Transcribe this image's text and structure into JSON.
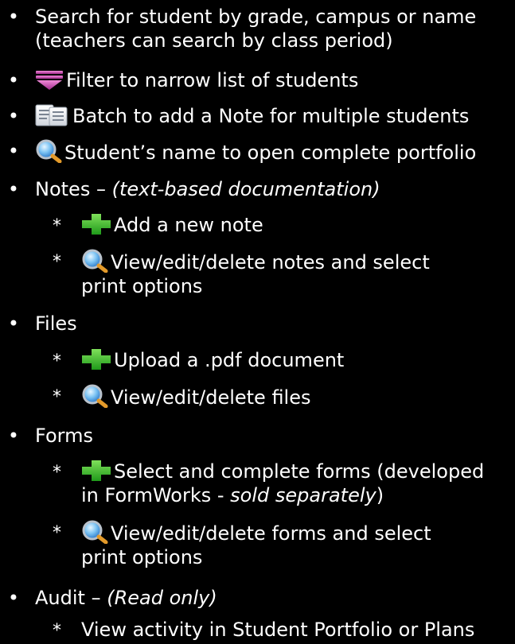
{
  "bullet_symbol": "•",
  "sub_symbol": "*",
  "items": {
    "search": {
      "line1": "Search for student by grade, campus or name",
      "line2": "(teachers can search by class period)"
    },
    "filter": {
      "text": "Filter to narrow list of students",
      "icon": "filter-funnel-icon"
    },
    "batch": {
      "text": "Batch to add a Note for multiple students",
      "icon": "documents-icon"
    },
    "portfolio": {
      "text": "Student’s name to open complete portfolio",
      "icon": "magnifier-icon"
    },
    "notes": {
      "title": "Notes – ",
      "desc": "(text-based documentation)",
      "add": "Add a new note",
      "view_line1": "View/edit/delete notes and select",
      "view_line2": "print options"
    },
    "files": {
      "title": "Files",
      "upload": "Upload a .pdf document",
      "view": "View/edit/delete files"
    },
    "forms": {
      "title": "Forms",
      "select_line1": "Select and complete forms (developed",
      "select_line2_a": "in FormWorks - ",
      "select_line2_b": "sold separately",
      "select_line2_c": ")",
      "view_line1": "View/edit/delete forms and select",
      "view_line2": "print options"
    },
    "audit": {
      "title": "Audit – ",
      "desc": "(Read only)",
      "view": "View activity in Student Portfolio or Plans"
    }
  },
  "colors": {
    "background": "#000000",
    "text": "#ffffff",
    "plus": "#3dbb2a",
    "funnel": "#c84bb0",
    "magnifier_lens": "#3a8fd8"
  }
}
